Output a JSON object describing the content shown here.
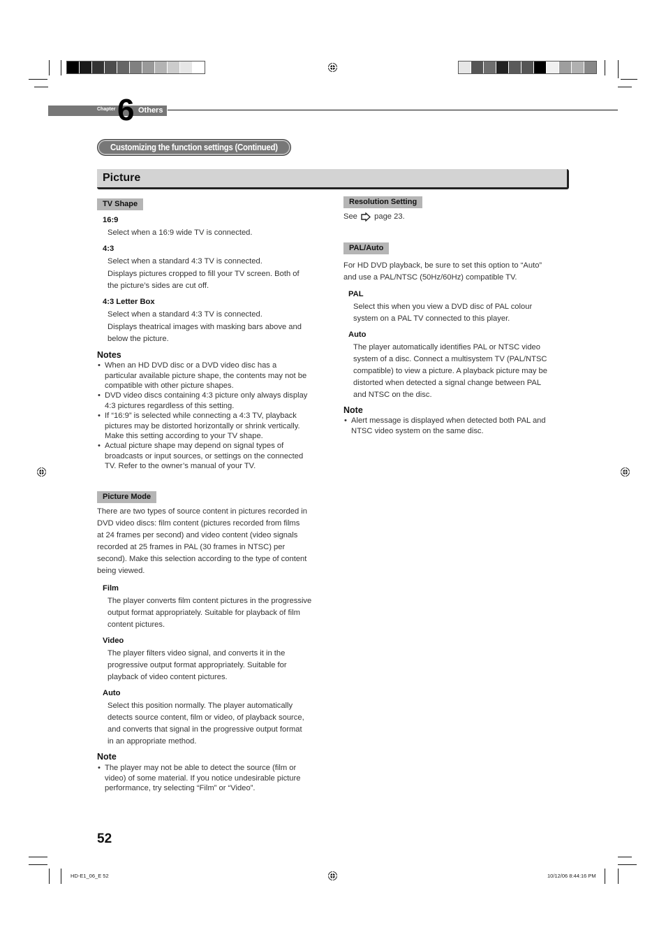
{
  "header": {
    "chapter_label": "Chapter",
    "chapter_number": "6",
    "chapter_title": "Others",
    "section_pill": "Customizing the function settings (Continued)",
    "section_title": "Picture"
  },
  "swatches": {
    "left": [
      "#000000",
      "#1a1a1a",
      "#333333",
      "#4d4d4d",
      "#666666",
      "#808080",
      "#999999",
      "#b3b3b3",
      "#cccccc",
      "#e6e6e6",
      "#ffffff"
    ],
    "right": [
      "#e6e6e6",
      "#555555",
      "#6e6e6e",
      "#222222",
      "#5a5a5a",
      "#555555",
      "#000000",
      "#f0f0f0",
      "#9e9e9e",
      "#b0b0b0",
      "#888888"
    ]
  },
  "left": {
    "tv_shape": {
      "tag": "TV Shape",
      "opt1": {
        "title": "16:9",
        "lines": [
          "Select when a 16:9 wide TV is connected."
        ]
      },
      "opt2": {
        "title": "4:3",
        "lines": [
          "Select when a standard 4:3 TV is connected.",
          "Displays pictures cropped to fill your TV screen. Both of",
          "the picture’s sides are cut off."
        ]
      },
      "opt3": {
        "title": "4:3 Letter Box",
        "lines": [
          "Select when a standard 4:3 TV is connected.",
          "Displays theatrical images with masking bars above and",
          "below the picture."
        ]
      },
      "notes_heading": "Notes",
      "notes": [
        [
          "When an HD DVD disc or a DVD video disc has a",
          "particular available picture shape, the contents may not be",
          "compatible with other picture shapes."
        ],
        [
          "DVD video discs containing 4:3 picture only always display",
          "4:3 pictures regardless of this setting."
        ],
        [
          "If “16:9” is selected while connecting a 4:3 TV, playback",
          "pictures may be distorted horizontally or shrink vertically.",
          "Make this setting according to your TV shape."
        ],
        [
          "Actual picture shape may depend on signal types of",
          "broadcasts or input sources, or settings on the connected",
          "TV. Refer to the owner’s manual of your TV."
        ]
      ]
    },
    "picture_mode": {
      "tag": "Picture Mode",
      "intro": [
        "There are two types of source content in pictures recorded in",
        "DVD video discs: film content (pictures recorded from films",
        "at 24 frames per second) and video content (video signals",
        "recorded at 25 frames in PAL (30 frames in NTSC) per",
        "second). Make this selection according to the type of content",
        "being viewed."
      ],
      "opt1": {
        "title": "Film",
        "lines": [
          "The player converts film content pictures in the progressive",
          "output format appropriately. Suitable for playback of film",
          "content pictures."
        ]
      },
      "opt2": {
        "title": "Video",
        "lines": [
          "The player filters video signal, and converts it in the",
          "progressive output format appropriately. Suitable for",
          "playback of video content pictures."
        ]
      },
      "opt3": {
        "title": "Auto",
        "lines": [
          "Select this position normally. The player automatically",
          "detects source content, film or video, of playback source,",
          "and converts that signal in the progressive output format",
          "in an appropriate method."
        ]
      },
      "note_heading": "Note",
      "note": [
        "The player may not be able to detect the source (film or",
        "video) of some material. If you notice undesirable picture",
        "performance, try selecting “Film” or “Video”."
      ]
    }
  },
  "right": {
    "resolution": {
      "tag": "Resolution Setting",
      "see": "See",
      "page_ref": "page 23."
    },
    "pal_auto": {
      "tag": "PAL/Auto",
      "intro": [
        "For HD DVD playback, be sure to set this option to “Auto”",
        "and use a PAL/NTSC (50Hz/60Hz) compatible TV."
      ],
      "opt1": {
        "title": "PAL",
        "lines": [
          "Select this when you view a DVD disc of PAL colour",
          "system on a PAL TV connected to this player."
        ]
      },
      "opt2": {
        "title": "Auto",
        "lines": [
          "The player automatically identifies PAL or NTSC video",
          "system of a disc. Connect a multisystem TV (PAL/NTSC",
          "compatible) to view a picture. A playback picture may be",
          "distorted when detected a signal change between PAL",
          "and NTSC on the disc."
        ]
      },
      "note_heading": "Note",
      "note": [
        "Alert message is displayed when detected both PAL and",
        "NTSC video system on the same disc."
      ]
    }
  },
  "footer": {
    "page_number": "52",
    "slug_left": "HD-E1_06_E   52",
    "slug_right": "10/12/06   8:44:16 PM",
    "bullet": "•"
  }
}
